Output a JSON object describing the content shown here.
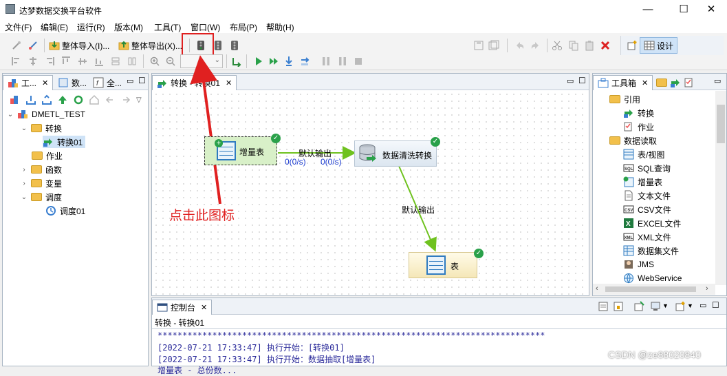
{
  "window": {
    "title": "达梦数据交换平台软件",
    "min": "—",
    "max": "☐",
    "close": "✕"
  },
  "menu": [
    "文件(F)",
    "编辑(E)",
    "运行(R)",
    "版本(M)",
    "工具(T)",
    "窗口(W)",
    "布局(P)",
    "帮助(H)"
  ],
  "toolbar": {
    "import_all": "整体导入(I)...",
    "export_all": "整体导出(X)...",
    "design": "设计"
  },
  "left_panel": {
    "tabs": [
      "工...",
      "数...",
      "全..."
    ],
    "tree": [
      {
        "label": "DMETL_TEST",
        "level": 0,
        "expanded": true
      },
      {
        "label": "转换",
        "level": 1,
        "expanded": true
      },
      {
        "label": "转换01",
        "level": 2
      },
      {
        "label": "作业",
        "level": 1
      },
      {
        "label": "函数",
        "level": 1
      },
      {
        "label": "变量",
        "level": 1
      },
      {
        "label": "调度",
        "level": 1,
        "expanded": true
      },
      {
        "label": "调度01",
        "level": 2
      }
    ]
  },
  "editor": {
    "tab": "转换 - 转换01",
    "nodes": {
      "incremental_table": "增量表",
      "data_cleanse": "数据清洗转换",
      "table": "表"
    },
    "edge_label_1": "默认输出",
    "edge_label_2": "默认输出",
    "rate_1": "0(0/s)",
    "rate_2": "0(0/s)",
    "annotation": "点击此图标"
  },
  "toolbox": {
    "tab": "工具箱",
    "items": [
      {
        "label": "引用",
        "type": "folder"
      },
      {
        "label": "转换",
        "type": "item"
      },
      {
        "label": "作业",
        "type": "item"
      },
      {
        "label": "数据读取",
        "type": "folder"
      },
      {
        "label": "表/视图",
        "type": "item"
      },
      {
        "label": "SQL查询",
        "type": "item"
      },
      {
        "label": "增量表",
        "type": "item"
      },
      {
        "label": "文本文件",
        "type": "item"
      },
      {
        "label": "CSV文件",
        "type": "item"
      },
      {
        "label": "EXCEL文件",
        "type": "item"
      },
      {
        "label": "XML文件",
        "type": "item"
      },
      {
        "label": "数据集文件",
        "type": "item"
      },
      {
        "label": "JMS",
        "type": "item"
      },
      {
        "label": "WebService",
        "type": "item"
      }
    ]
  },
  "console": {
    "tab": "控制台",
    "subtitle": "转换 - 转换01",
    "stars": "******************************************************************************",
    "lines": [
      "[2022-07-21 17:33:47] 执行开始：[转换01]",
      "[2022-07-21 17:33:47] 执行开始：数据抽取[增量表]",
      "    增量表 - 总份数..."
    ]
  },
  "watermark": "CSDN @ze88020840",
  "colors": {
    "accent_red": "#e02020",
    "edge_green": "#6fc21f",
    "console_blue": "#2a2a9a"
  }
}
